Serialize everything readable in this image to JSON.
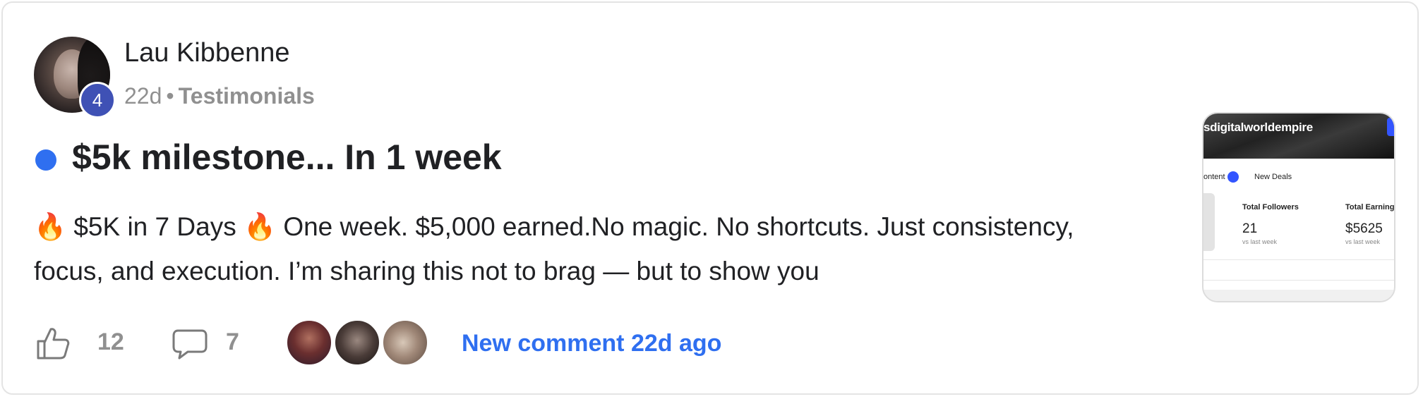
{
  "post": {
    "author": {
      "name": "Lau Kibbenne",
      "level": "4"
    },
    "meta": {
      "time": "22d",
      "separator": "•",
      "category": "Testimonials"
    },
    "title": "$5k milestone... In 1 week",
    "body": "🔥  $5K in 7 Days 🔥  One week. $5,000 earned.No magic. No shortcuts. Just consistency, focus, and execution. I’m sharing this not to brag — but to show you",
    "thumbnail": {
      "handle": "sdigitalworldempire",
      "nav_left": "ontent",
      "nav_right": "New Deals",
      "stats": [
        {
          "label": "Total Followers",
          "value": "21",
          "sub": "vs last week"
        },
        {
          "label": "Total Earnings",
          "value": "$5625",
          "sub": "vs last week"
        }
      ]
    },
    "actions": {
      "likes": "12",
      "comments": "7",
      "new_comment": "New comment 22d ago"
    },
    "colors": {
      "accent": "#2f6ff0",
      "level_badge": "#3f51b5",
      "muted": "#909090"
    },
    "icons": {
      "like": "thumbs-up-icon",
      "comment": "speech-bubble-icon",
      "unread": "unread-dot"
    }
  }
}
